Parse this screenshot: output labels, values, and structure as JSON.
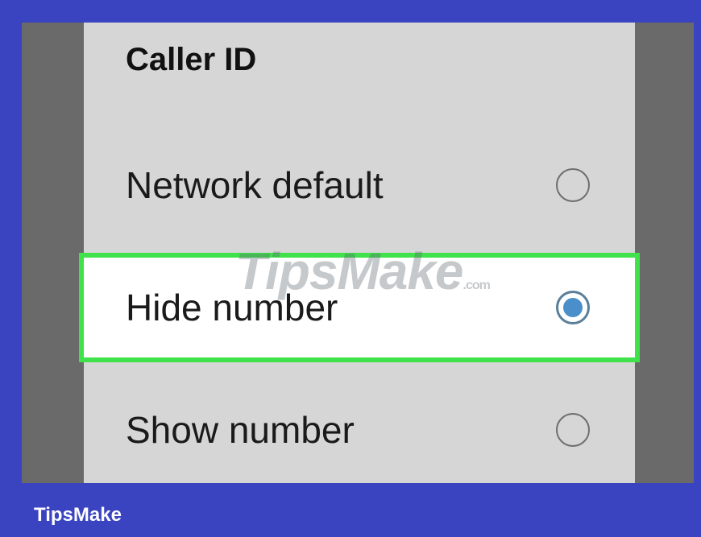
{
  "dialog": {
    "title": "Caller ID",
    "options": [
      {
        "label": "Network default",
        "selected": false
      },
      {
        "label": "Hide number",
        "selected": true
      },
      {
        "label": "Show number",
        "selected": false
      }
    ]
  },
  "watermark": {
    "text": "TipsMake",
    "suffix": ".com"
  },
  "footer": {
    "brand": "TipsMake"
  },
  "colors": {
    "frame": "#3a43c0",
    "highlight_border": "#3fe24a",
    "radio_selected": "#4a8fc9"
  }
}
